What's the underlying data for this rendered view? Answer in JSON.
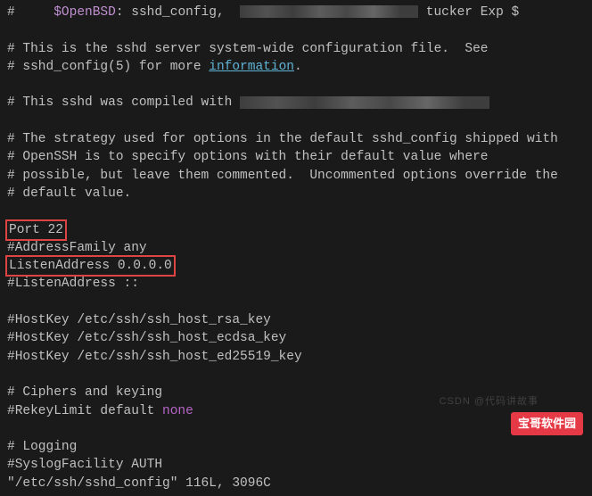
{
  "header": {
    "prefix": "#",
    "var": "$OpenBSD",
    "file": ": sshd_config,",
    "suffix": "tucker Exp $"
  },
  "intro": {
    "line1": "# This is the sshd server system-wide configuration file.  See",
    "line2_pre": "# sshd_config(5) for more ",
    "line2_link": "information",
    "line2_post": "."
  },
  "compiled": {
    "text": "# This sshd was compiled with "
  },
  "strategy": {
    "line1": "# The strategy used for options in the default sshd_config shipped with",
    "line2": "# OpenSSH is to specify options with their default value where",
    "line3": "# possible, but leave them commented.  Uncommented options override the",
    "line4": "# default value."
  },
  "port": {
    "label": "Port 22"
  },
  "addressfamily": {
    "label": "#AddressFamily any"
  },
  "listen1": {
    "label": "ListenAddress 0.0.0.0"
  },
  "listen2": {
    "label": "#ListenAddress ::"
  },
  "hostkeys": {
    "rsa": "#HostKey /etc/ssh/ssh_host_rsa_key",
    "ecdsa": "#HostKey /etc/ssh/ssh_host_ecdsa_key",
    "ed25519": "#HostKey /etc/ssh/ssh_host_ed25519_key"
  },
  "ciphers": {
    "header": "# Ciphers and keying",
    "rekey_pre": "#RekeyLimit default ",
    "rekey_val": "none"
  },
  "logging": {
    "header": "# Logging",
    "syslog": "#SyslogFacility AUTH"
  },
  "status": {
    "text": "\"/etc/ssh/sshd_config\" 116L, 3096C"
  },
  "watermarks": {
    "brand": "宝哥软件园",
    "credit": "CSDN @代码讲故事"
  }
}
